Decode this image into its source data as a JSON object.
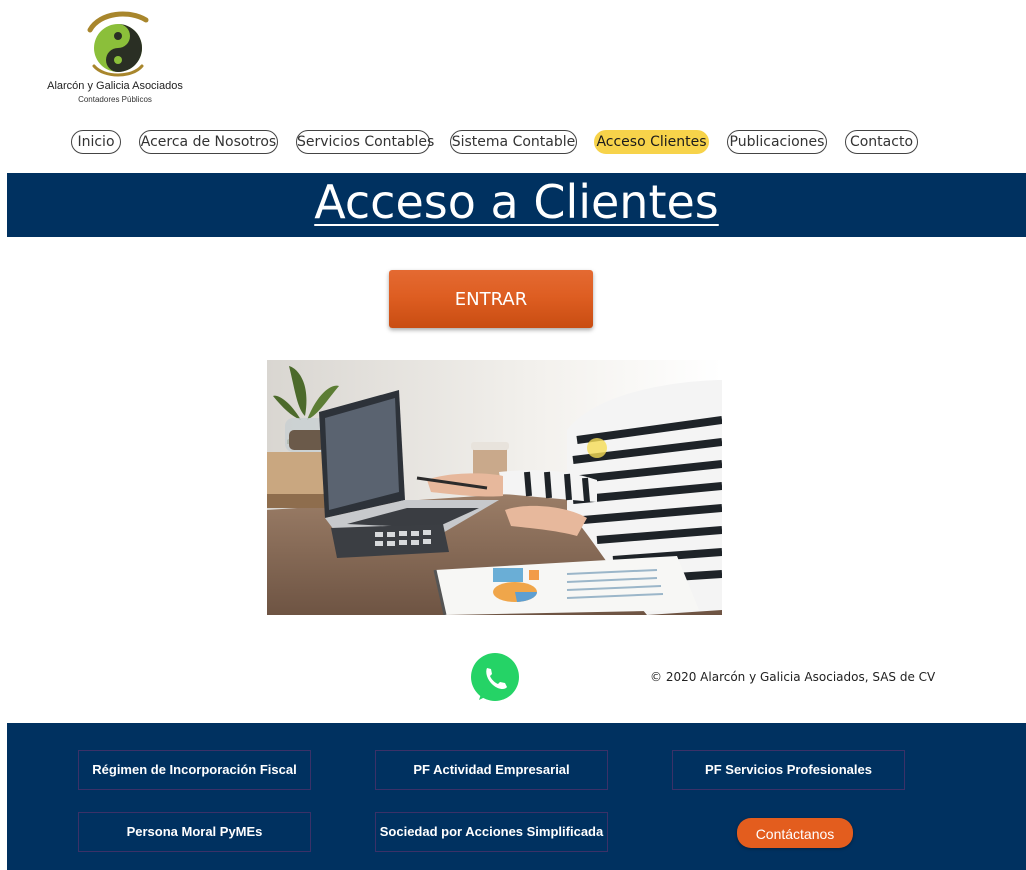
{
  "brand": {
    "name": "Alarcón y Galicia Asociados",
    "tagline": "Contadores Públicos",
    "accent_green": "#8bbf3a",
    "accent_olive": "#a8862c"
  },
  "nav": {
    "items": [
      {
        "label": "Inicio"
      },
      {
        "label": "Acerca de Nosotros"
      },
      {
        "label": "Servicios Contables"
      },
      {
        "label": "Sistema Contable"
      },
      {
        "label": "Acceso Clientes",
        "active": true
      },
      {
        "label": "Publicaciones"
      },
      {
        "label": "Contacto"
      }
    ],
    "active_color": "#f7d34a"
  },
  "page": {
    "title": "Acceso a Clientes",
    "band_color": "#003160",
    "enter_label": "ENTRAR",
    "enter_color": "#de5e22"
  },
  "footer_top": {
    "copyright": "© 2020  Alarcón y Galicia Asociados, SAS de CV",
    "whatsapp_icon": "whatsapp-icon"
  },
  "footer": {
    "links": [
      {
        "label": "Régimen de Incorporación Fiscal"
      },
      {
        "label": "PF Actividad Empresarial"
      },
      {
        "label": "PF Servicios Profesionales"
      },
      {
        "label": "Persona Moral PyMEs"
      },
      {
        "label": "Sociedad por Acciones Simplificada"
      }
    ],
    "contact_label": "Contáctanos",
    "contact_color": "#e35d1e"
  }
}
